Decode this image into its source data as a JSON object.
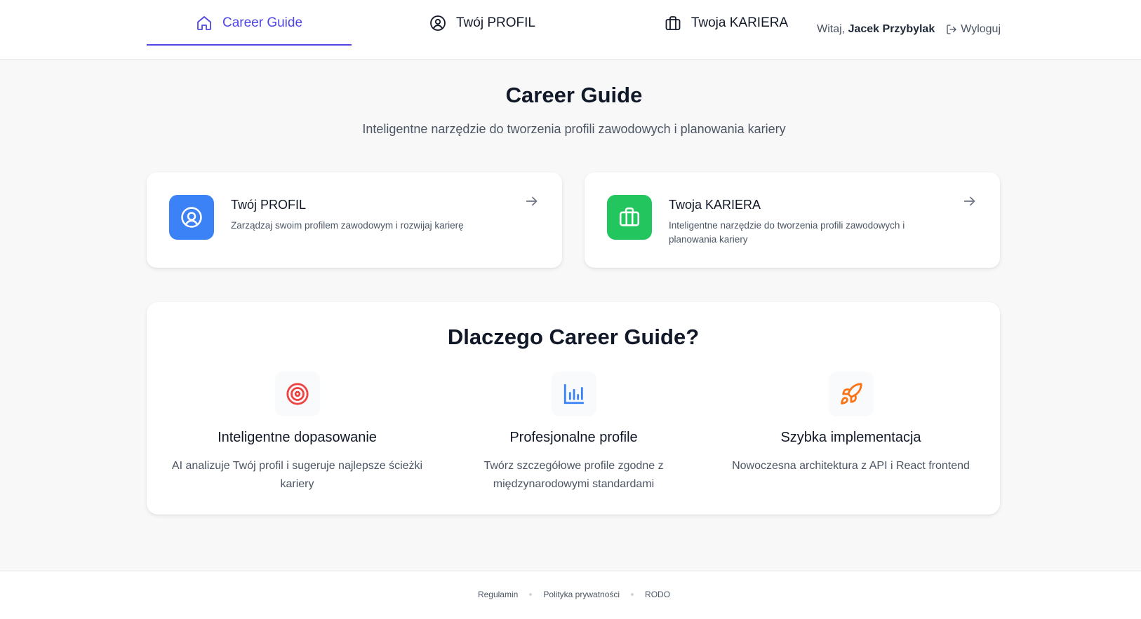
{
  "nav": {
    "tabs": [
      {
        "label": "Career Guide",
        "icon": "home-icon",
        "active": true
      },
      {
        "label": "Twój PROFIL",
        "icon": "user-circle-icon",
        "active": false
      },
      {
        "label": "Twoja KARIERA",
        "icon": "briefcase-icon",
        "active": false
      }
    ],
    "greeting": "Witaj,",
    "user_name": "Jacek Przybylak",
    "logout_label": "Wyloguj",
    "accent_color": "#4f46e5"
  },
  "hero": {
    "title": "Career Guide",
    "subtitle": "Inteligentne narzędzie do tworzenia profili zawodowych i planowania kariery"
  },
  "cards": [
    {
      "title": "Twój PROFIL",
      "description": "Zarządzaj swoim profilem zawodowym i rozwijaj karierę",
      "icon": "user-circle-icon",
      "color": "#3b82f6"
    },
    {
      "title": "Twoja KARIERA",
      "description": "Inteligentne narzędzie do tworzenia profili zawodowych i planowania kariery",
      "icon": "briefcase-icon",
      "color": "#22c55e"
    }
  ],
  "why": {
    "title": "Dlaczego Career Guide?",
    "features": [
      {
        "title": "Inteligentne dopasowanie",
        "description": "AI analizuje Twój profil i sugeruje najlepsze ścieżki kariery",
        "icon": "target-icon",
        "color": "#ef4444"
      },
      {
        "title": "Profesjonalne profile",
        "description": "Twórz szczegółowe profile zgodne z międzynarodowymi standardami",
        "icon": "bar-chart-icon",
        "color": "#3b82f6"
      },
      {
        "title": "Szybka implementacja",
        "description": "Nowoczesna architektura z API i React frontend",
        "icon": "rocket-icon",
        "color": "#f97316"
      }
    ]
  },
  "footer": {
    "links": [
      "Regulamin",
      "Polityka prywatności",
      "RODO"
    ]
  }
}
